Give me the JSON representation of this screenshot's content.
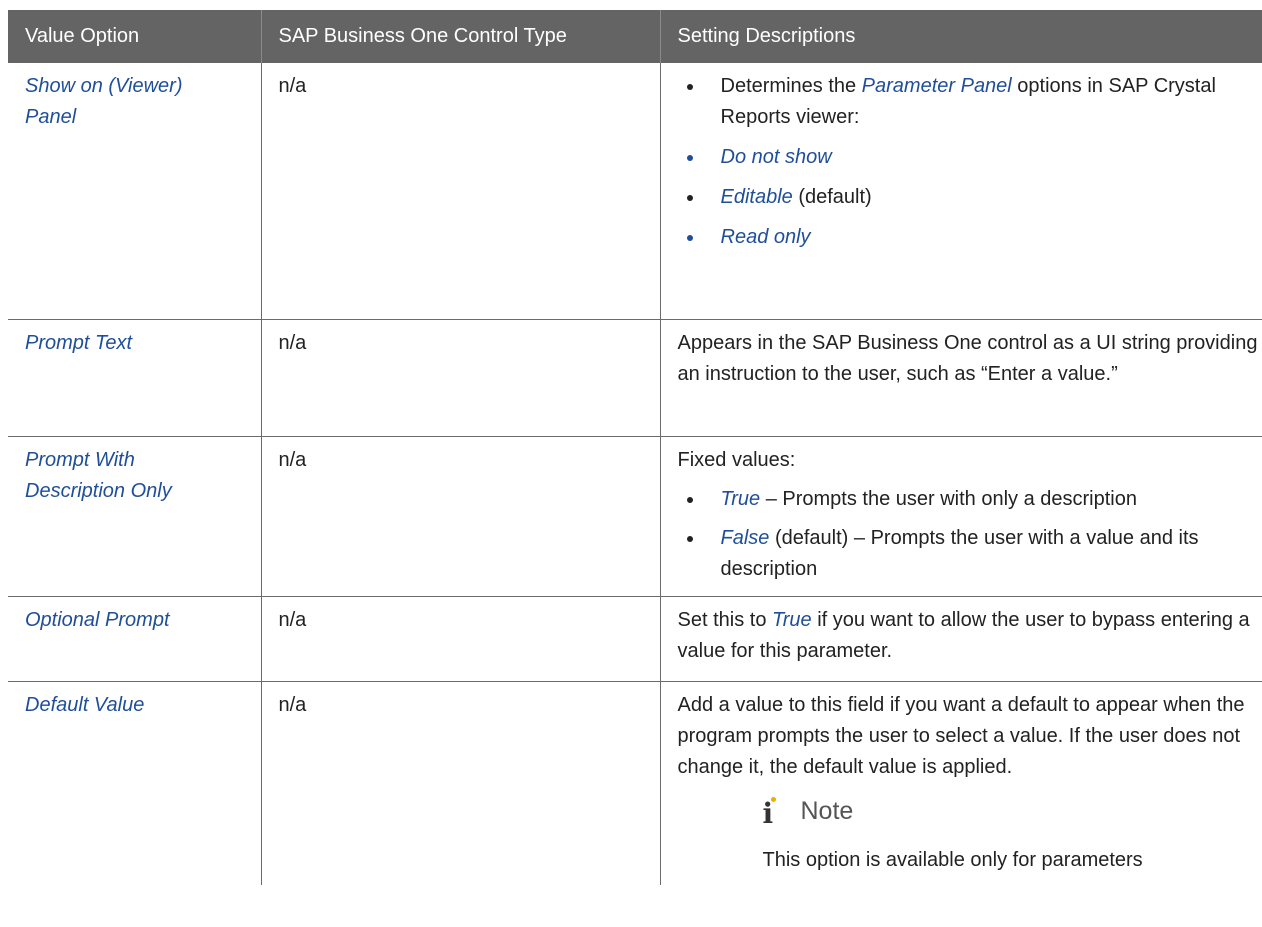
{
  "columns": [
    "Value Option",
    "SAP Business One Control Type",
    "Setting Descriptions"
  ],
  "rows": [
    {
      "option": [
        "Show on (Viewer)",
        "Panel"
      ],
      "control": "n/a",
      "desc": {
        "b1_pre": "Determines the ",
        "b1_em": "Parameter Panel",
        "b1_post": " options in SAP Crystal Reports viewer:",
        "b2": "Do not show",
        "b3_em": "Editable",
        "b3_post": " (default)",
        "b4": "Read only"
      }
    },
    {
      "option": [
        "Prompt Text"
      ],
      "control": "n/a",
      "desc": {
        "p": "Appears in the SAP Business One control as a UI string providing an instruction to the user, such as “Enter a value.”"
      }
    },
    {
      "option": [
        "Prompt With",
        "Description Only"
      ],
      "control": "n/a",
      "desc": {
        "intro": "Fixed values:",
        "b1_em": "True",
        "b1_post": " – Prompts the user with only a description",
        "b2_em": "False",
        "b2_post": " (default) – Prompts the user with a value and its description"
      }
    },
    {
      "option": [
        "Optional Prompt"
      ],
      "control": "n/a",
      "desc": {
        "pre": "Set this to ",
        "em": "True",
        "post": " if you want to allow the user to bypass entering a value for this parameter."
      }
    },
    {
      "option": [
        "Default Value"
      ],
      "control": "n/a",
      "desc": {
        "p": "Add a value to this field if you want a default to appear when the program prompts the user to select a value. If the user does not change it, the default value is applied.",
        "note_title": "Note",
        "note_text": "This option is available only for parameters"
      }
    }
  ]
}
